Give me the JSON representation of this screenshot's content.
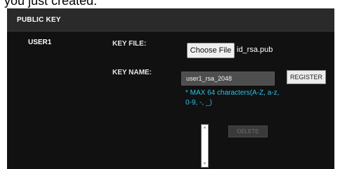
{
  "caption": "you just created.",
  "panel": {
    "title": "PUBLIC KEY",
    "user": "USER1",
    "key_file_label": "KEY FILE:",
    "choose_file_label": "Choose File",
    "selected_file": "id_rsa.pub",
    "key_name_label": "KEY NAME:",
    "key_name_value": "user1_rsa_2048",
    "register_label": "REGISTER",
    "hint": "* MAX 64 characters(A-Z, a-z, 0-9, -, _)",
    "delete_label": "DELETE"
  },
  "icons": {
    "scroll_up": "triangle-up",
    "scroll_down": "triangle-down"
  },
  "colors": {
    "panel_bg": "#111111",
    "header_bg": "#2a2a2a",
    "hint_color": "#2ec1e6"
  }
}
